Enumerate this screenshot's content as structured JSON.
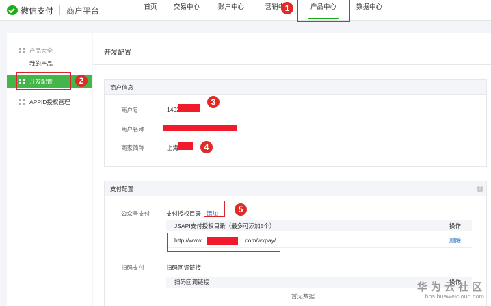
{
  "header": {
    "brand": "微信支付",
    "platform": "商户平台",
    "nav": [
      "首页",
      "交易中心",
      "账户中心",
      "营销中",
      "产品中心",
      "数据中心"
    ]
  },
  "sidebar": {
    "group_label": "产品大全",
    "sub_item": "我的产品",
    "active_item": "开发配置",
    "other_item": "APPID授权管理"
  },
  "main": {
    "page_title": "开发配置",
    "merchant": {
      "section_title": "商户信息",
      "id_label": "商户号",
      "id_value": "149269",
      "name_label": "商户名称",
      "short_label": "商家简称",
      "short_value": "上海"
    },
    "pay": {
      "section_title": "支付配置",
      "help": "?",
      "jsapi_label": "公众号支付",
      "auth_dir_label": "支付授权目录",
      "add_link": "添加",
      "table_header": "JSAPI支付授权目录（最多可添加5个）",
      "op_header": "操作",
      "url_prefix": "http://www",
      "url_suffix": ".com/wxpay/",
      "delete_link": "删除",
      "scan_label": "扫码支付",
      "callback_label": "扫码回调链接",
      "callback_header": "扫码回调链接",
      "callback_op": "操作",
      "empty_text": "暂无数据"
    }
  },
  "annotations": [
    "1",
    "2",
    "3",
    "4",
    "5"
  ],
  "watermark": {
    "cn": "华为云社区",
    "en": "bbs.huaweicloud.com"
  },
  "colors": {
    "accent": "#44b549",
    "annotation": "#e02b27",
    "link": "#1a71c4"
  }
}
